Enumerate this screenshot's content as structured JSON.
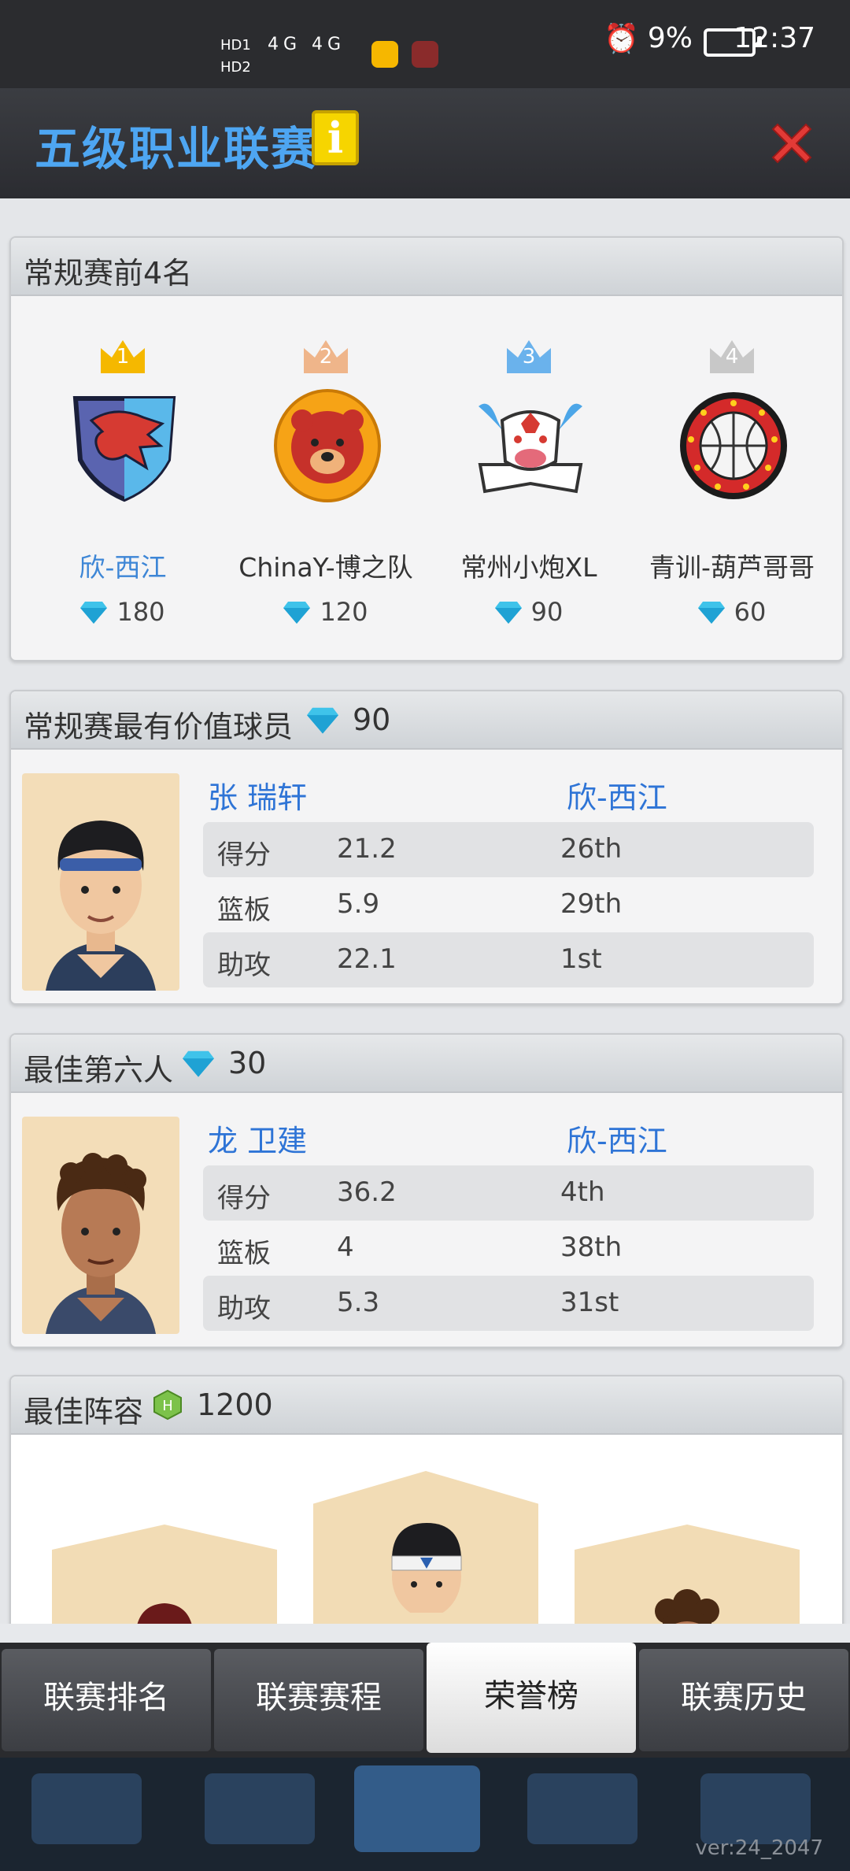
{
  "status_bar": {
    "time": "12:37",
    "battery": "9%",
    "hd_labels": "HD1 HD2",
    "signal_labels": "4G 4G"
  },
  "header": {
    "title": "五级职业联赛",
    "info_icon": "i"
  },
  "top4": {
    "title": "常规赛前4名",
    "teams": [
      {
        "rank": "1",
        "name": "欣-西江",
        "points": "180",
        "crown_color": "#f5b800"
      },
      {
        "rank": "2",
        "name": "ChinaY-博之队",
        "points": "120",
        "crown_color": "#efb58a"
      },
      {
        "rank": "3",
        "name": "常州小炮XL",
        "points": "90",
        "crown_color": "#6ab2ec"
      },
      {
        "rank": "4",
        "name": "青训-葫芦哥哥",
        "points": "60",
        "crown_color": "#c8c8c8"
      }
    ]
  },
  "mvp": {
    "title": "常规赛最有价值球员",
    "reward": "90",
    "player": "张 瑞轩",
    "team": "欣-西江",
    "stats": [
      {
        "label": "得分",
        "value": "21.2",
        "rank": "26th"
      },
      {
        "label": "篮板",
        "value": "5.9",
        "rank": "29th"
      },
      {
        "label": "助攻",
        "value": "22.1",
        "rank": "1st"
      }
    ]
  },
  "sixth_man": {
    "title": "最佳第六人",
    "reward": "30",
    "player": "龙 卫建",
    "team": "欣-西江",
    "stats": [
      {
        "label": "得分",
        "value": "36.2",
        "rank": "4th"
      },
      {
        "label": "篮板",
        "value": "4",
        "rank": "38th"
      },
      {
        "label": "助攻",
        "value": "5.3",
        "rank": "31st"
      }
    ]
  },
  "lineup": {
    "title": "最佳阵容",
    "reward": "1200"
  },
  "tabs": [
    {
      "label": "联赛排名"
    },
    {
      "label": "联赛赛程"
    },
    {
      "label": "荣誉榜"
    },
    {
      "label": "联赛历史"
    }
  ],
  "version": "ver:24_2047"
}
